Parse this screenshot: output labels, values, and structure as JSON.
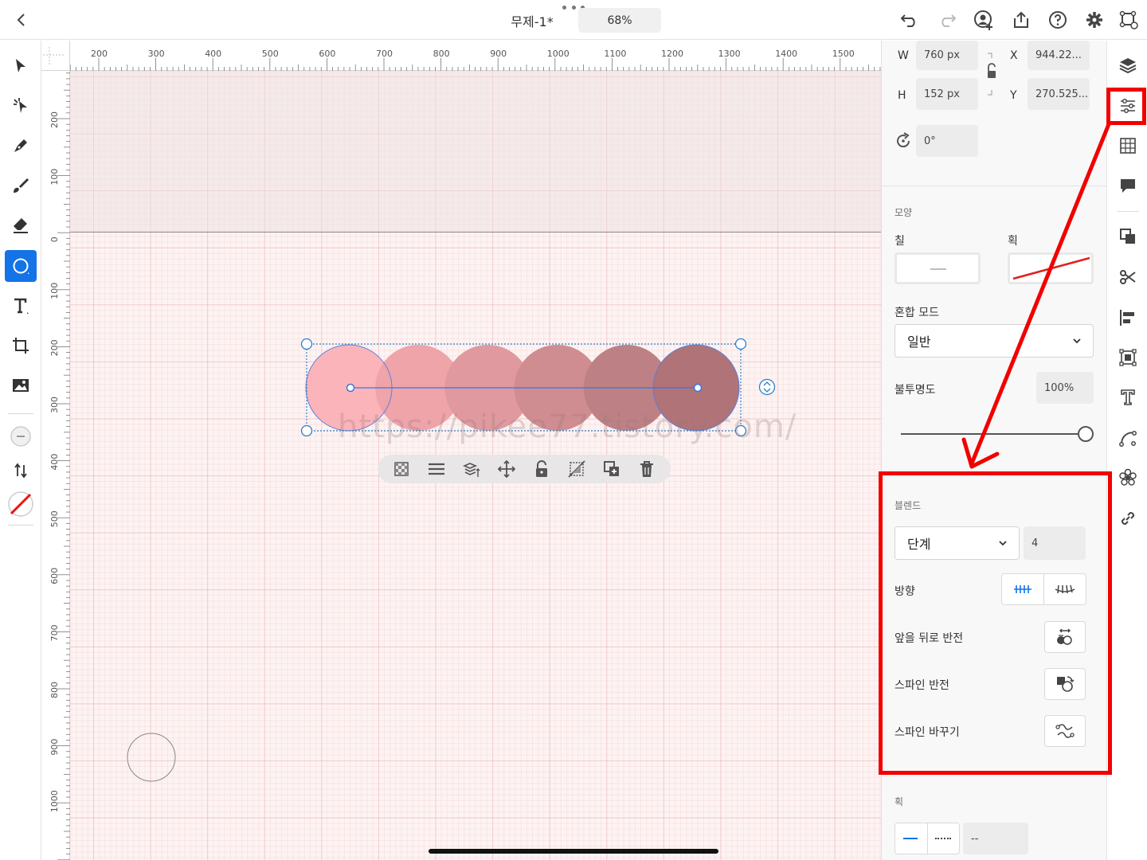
{
  "top_bar": {
    "back_icon": "chevron-left-icon",
    "title": "무제-1*",
    "zoom": "68%",
    "right_icons": [
      "undo-icon",
      "redo-icon",
      "invite-user-icon",
      "share-icon",
      "help-icon",
      "settings-icon",
      "artboard-icon"
    ]
  },
  "left_tools": [
    "select-icon",
    "direct-select-icon",
    "pen-icon",
    "brush-icon",
    "eraser-icon",
    "shape-ellipse-icon",
    "text-icon",
    "crop-transform-icon",
    "image-icon",
    "fill-swatch-icon",
    "swap-icon",
    "stroke-none-icon"
  ],
  "rulers": {
    "horizontal": [
      "200",
      "300",
      "400",
      "500",
      "600",
      "700",
      "800",
      "900",
      "1000",
      "1100",
      "1200",
      "1300",
      "1400",
      "1500"
    ],
    "vertical": [
      "200",
      "100",
      "0",
      "100",
      "200",
      "300",
      "400",
      "500",
      "600",
      "700",
      "800",
      "900",
      "1000"
    ]
  },
  "canvas": {
    "blend_colors": [
      "#fbb4b9",
      "#eea4a9",
      "#e09a9f",
      "#cf8d91",
      "#bd8185",
      "#b07378"
    ],
    "watermark": "https://pikee77.tistory.com/",
    "float_toolbar": [
      "transparency-icon",
      "align-menu-icon",
      "arrange-icon",
      "move-icon",
      "lock-icon",
      "flip-icon",
      "duplicate-icon",
      "delete-icon"
    ]
  },
  "properties": {
    "w_label": "W",
    "w_value": "760 px",
    "h_label": "H",
    "h_value": "152 px",
    "x_label": "X",
    "x_value": "944.22...",
    "y_label": "Y",
    "y_value": "270.525...",
    "rotation_value": "0°",
    "appearance_heading": "모양",
    "fill_label": "칠",
    "stroke_label": "획",
    "blend_mode_label": "혼합 모드",
    "blend_mode_value": "일반",
    "opacity_label": "불투명도",
    "opacity_value": "100%",
    "opacity_fraction": 1.0,
    "blend_heading": "블렌드",
    "blend_type_value": "단계",
    "blend_steps_value": "4",
    "direction_label": "방향",
    "reverse_front_back_label": "앞을 뒤로 반전",
    "reverse_spine_label": "스파인 반전",
    "replace_spine_label": "스파인 바꾸기",
    "stroke_heading": "획",
    "stroke_dash_value": "--"
  },
  "right_strip": [
    "layers-icon",
    "properties-icon",
    "grid-icon",
    "comments-icon",
    "pathfinder-icon",
    "scissors-icon",
    "align-icon",
    "transform-icon",
    "type-icon",
    "path-icon",
    "recolor-icon",
    "link-icon"
  ],
  "annotation_color": "#f20000"
}
